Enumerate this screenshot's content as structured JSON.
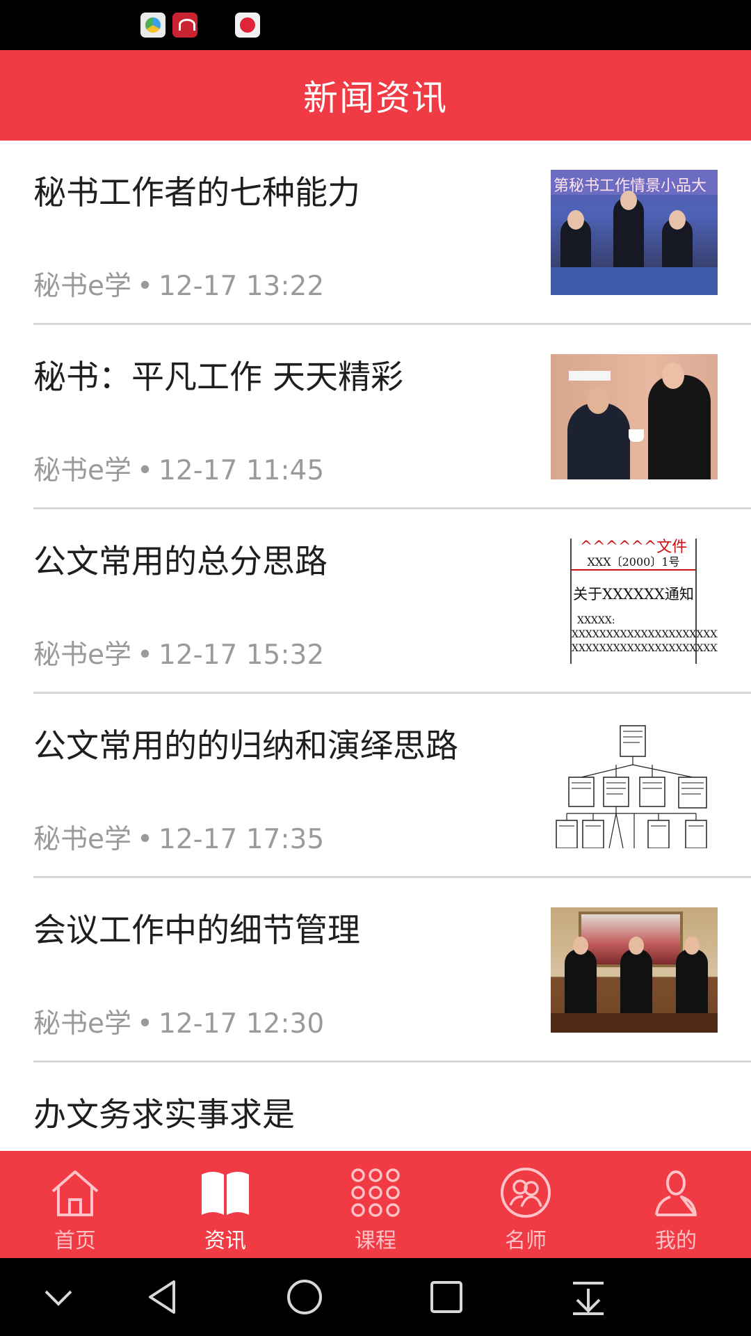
{
  "status_bar": {
    "icons": [
      "browser-app-icon",
      "huawei-app-icon",
      "video-app-icon"
    ]
  },
  "header": {
    "title": "新闻资讯"
  },
  "news": [
    {
      "title": "秘书工作者的七种能力",
      "source": "秘书e学",
      "time": "12-17 13:22",
      "thumbnail": {
        "banner": "第秘书工作情景小品大"
      }
    },
    {
      "title": "秘书：平凡工作 天天精彩",
      "source": "秘书e学",
      "time": "12-17 11:45"
    },
    {
      "title": "公文常用的总分思路",
      "source": "秘书e学",
      "time": "12-17 15:32",
      "thumbnail": {
        "lines": [
          "^^^^^^文件",
          "XXX〔2000〕1号",
          "关于XXXXXX通知",
          "XXXXX:",
          "XXXXXXXXXXXXXXXXXXXXXXXXXX",
          "XXXXXXXXXXXXXXXXXXXXXXXXXXX"
        ]
      }
    },
    {
      "title": "公文常用的的归纳和演绎思路",
      "source": "秘书e学",
      "time": "12-17 17:35"
    },
    {
      "title": "会议工作中的细节管理",
      "source": "秘书e学",
      "time": "12-17 12:30"
    },
    {
      "title": "办文务求实事求是",
      "source": "",
      "time": ""
    }
  ],
  "meta_separator": "•",
  "bottom_nav": [
    {
      "label": "首页",
      "icon": "home-icon",
      "active": false
    },
    {
      "label": "资讯",
      "icon": "book-icon",
      "active": true
    },
    {
      "label": "课程",
      "icon": "grid-dots-icon",
      "active": false
    },
    {
      "label": "名师",
      "icon": "teachers-icon",
      "active": false
    },
    {
      "label": "我的",
      "icon": "person-icon",
      "active": false
    }
  ],
  "system_nav": [
    "collapse-icon",
    "back-icon",
    "home-circle-icon",
    "recents-icon",
    "notification-pull-icon"
  ],
  "colors": {
    "brand_red": "#f03a44",
    "nav_inactive": "#ffc2c6",
    "title_text": "#1e1e1e",
    "meta_text": "#9a9a9a",
    "divider": "#d6d6d6"
  }
}
